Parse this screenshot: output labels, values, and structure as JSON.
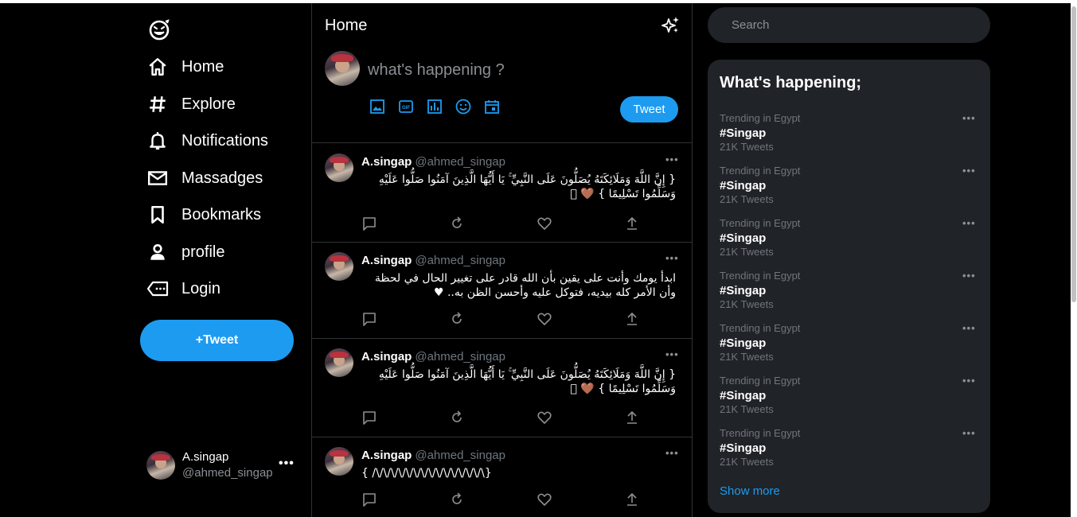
{
  "colors": {
    "accent": "#1d9bf0",
    "background": "#000000",
    "panel": "#202327",
    "muted": "#8b8f93"
  },
  "sidebar": {
    "logo_icon": "smiley-logo-icon",
    "items": [
      {
        "label": "Home",
        "icon": "home-icon"
      },
      {
        "label": "Explore",
        "icon": "hashtag-icon"
      },
      {
        "label": "Notifications",
        "icon": "bell-icon"
      },
      {
        "label": "Massadges",
        "icon": "envelope-icon"
      },
      {
        "label": "Bookmarks",
        "icon": "bookmark-icon"
      },
      {
        "label": "profile",
        "icon": "person-icon"
      },
      {
        "label": "Login",
        "icon": "login-icon"
      }
    ],
    "tweet_button": "+Tweet",
    "account": {
      "name": "A.singap",
      "handle": "@ahmed_singap",
      "more": "•••"
    }
  },
  "header": {
    "title": "Home",
    "sparkle_icon": "sparkle-icon"
  },
  "composer": {
    "placeholder": "what's happening ?",
    "tools": [
      "image-icon",
      "gif-icon",
      "poll-icon",
      "emoji-icon",
      "schedule-icon"
    ],
    "tweet_button": "Tweet"
  },
  "feed": [
    {
      "name": "A.singap",
      "handle": "@ahmed_singap",
      "text": "{ إِنَّ اللَّهَ وَمَلَائِكَتَهُ يُصَلُّونَ عَلَى النَّبِيِّ ۚ يَا أَيُّهَا الَّذِينَ آمَنُوا صَلُّوا عَلَيْهِ وَسَلِّمُوا تَسْلِيمًا } 🤎 ⃞",
      "more": "•••"
    },
    {
      "name": "A.singap",
      "handle": "@ahmed_singap",
      "text": "ابدأ يومك وأنت على يقين بأن الله قادر على تغيير الحال في لحظة وأن الأمر كله بيديه، فتوكل عليه وأحسن الظن به.. ♥",
      "more": "•••"
    },
    {
      "name": "A.singap",
      "handle": "@ahmed_singap",
      "text": "{ إِنَّ اللَّهَ وَمَلَائِكَتَهُ يُصَلُّونَ عَلَى النَّبِيِّ ۚ يَا أَيُّهَا الَّذِينَ آمَنُوا صَلُّوا عَلَيْهِ وَسَلِّمُوا تَسْلِيمًا } 🤎 ⃞",
      "more": "•••"
    },
    {
      "name": "A.singap",
      "handle": "@ahmed_singap",
      "text": "{ /\\/\\/\\/\\/\\/\\/\\/\\/\\/\\/\\/\\/\\/\\/\\}",
      "more": "•••"
    }
  ],
  "search": {
    "placeholder": "Search"
  },
  "trends": {
    "title": "What's happening;",
    "items": [
      {
        "category": "Trending in Egypt",
        "tag": "#Singap",
        "count": "21K Tweets"
      },
      {
        "category": "Trending in Egypt",
        "tag": "#Singap",
        "count": "21K Tweets"
      },
      {
        "category": "Trending in Egypt",
        "tag": "#Singap",
        "count": "21K Tweets"
      },
      {
        "category": "Trending in Egypt",
        "tag": "#Singap",
        "count": "21K Tweets"
      },
      {
        "category": "Trending in Egypt",
        "tag": "#Singap",
        "count": "21K Tweets"
      },
      {
        "category": "Trending in Egypt",
        "tag": "#Singap",
        "count": "21K Tweets"
      },
      {
        "category": "Trending in Egypt",
        "tag": "#Singap",
        "count": "21K Tweets"
      }
    ],
    "more": "•••",
    "show_more": "Show more"
  }
}
